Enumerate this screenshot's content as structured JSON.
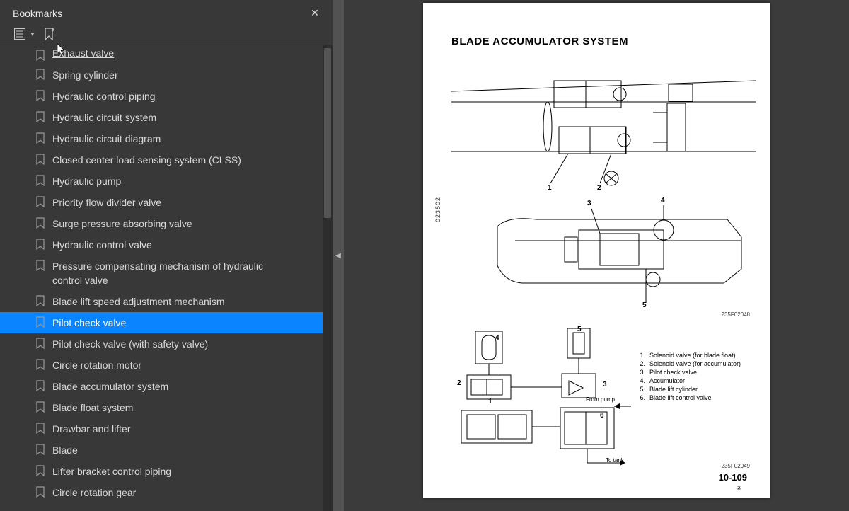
{
  "sidebar": {
    "title": "Bookmarks",
    "items": [
      {
        "label": "Exhaust valve",
        "first": true
      },
      {
        "label": "Spring cylinder"
      },
      {
        "label": "Hydraulic control piping"
      },
      {
        "label": "Hydraulic circuit system"
      },
      {
        "label": "Hydraulic circuit diagram"
      },
      {
        "label": "Closed center load sensing system (CLSS)"
      },
      {
        "label": "Hydraulic pump"
      },
      {
        "label": "Priority flow divider valve"
      },
      {
        "label": "Surge pressure absorbing valve"
      },
      {
        "label": "Hydraulic control valve"
      },
      {
        "label": "Pressure compensating mechanism of hydraulic control valve",
        "wrap": true
      },
      {
        "label": "Blade lift speed adjustment mechanism"
      },
      {
        "label": "Pilot check valve",
        "selected": true
      },
      {
        "label": "Pilot check valve (with safety valve)"
      },
      {
        "label": "Circle rotation motor"
      },
      {
        "label": "Blade accumulator system"
      },
      {
        "label": "Blade float system"
      },
      {
        "label": "Drawbar and lifter"
      },
      {
        "label": "Blade"
      },
      {
        "label": "Lifter bracket control piping"
      },
      {
        "label": "Circle rotation gear"
      }
    ]
  },
  "page": {
    "title": "BLADE ACCUMULATOR SYSTEM",
    "vertical_code": "023502",
    "fig_id_1": "235F02048",
    "fig_id_2": "235F02049",
    "from_pump": "From pump",
    "to_tank": "To tank",
    "page_number": "10-109",
    "page_sub": "②",
    "callouts_top": {
      "1": "1",
      "2": "2",
      "3": "3",
      "4": "4",
      "5": "5"
    },
    "legend": [
      {
        "n": "1.",
        "t": "Solenoid valve (for blade float)"
      },
      {
        "n": "2.",
        "t": "Solenoid valve (for accumulator)"
      },
      {
        "n": "3.",
        "t": "Pilot check valve"
      },
      {
        "n": "4.",
        "t": "Accumulator"
      },
      {
        "n": "5.",
        "t": "Blade lift cylinder"
      },
      {
        "n": "6.",
        "t": "Blade lift control valve"
      }
    ],
    "sch_labels": {
      "1": "1",
      "2": "2",
      "3": "3",
      "4": "4",
      "5": "5",
      "6": "6"
    }
  }
}
